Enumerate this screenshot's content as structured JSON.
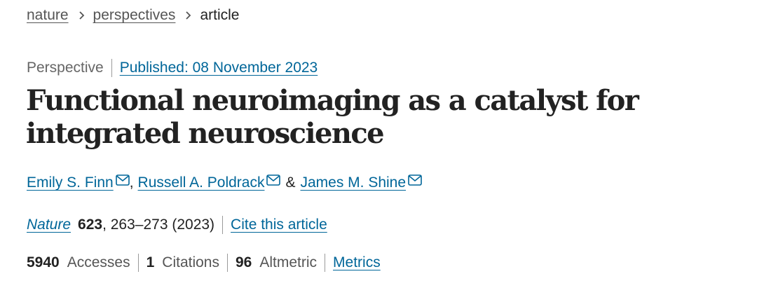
{
  "breadcrumb": {
    "items": [
      "nature",
      "perspectives"
    ],
    "current": "article"
  },
  "article": {
    "type": "Perspective",
    "published": "Published: 08 November 2023",
    "title": "Functional neuroimaging as a catalyst for integrated neuroscience",
    "authors": [
      "Emily S. Finn",
      "Russell A. Poldrack",
      "James M. Shine"
    ],
    "author_separators": [
      ",",
      "&"
    ],
    "journal": "Nature",
    "volume": "623",
    "pages_year": ", 263–273 (2023)",
    "cite_label": "Cite this article"
  },
  "metrics": {
    "accesses_count": "5940",
    "accesses_label": "Accesses",
    "citations_count": "1",
    "citations_label": "Citations",
    "altmetric_count": "96",
    "altmetric_label": "Altmetric",
    "metrics_link": "Metrics"
  },
  "colors": {
    "link": "#006699",
    "text": "#222222",
    "muted": "#555555"
  },
  "icons": {
    "separator": "chevron-right-icon",
    "author_contact": "mail-icon"
  }
}
